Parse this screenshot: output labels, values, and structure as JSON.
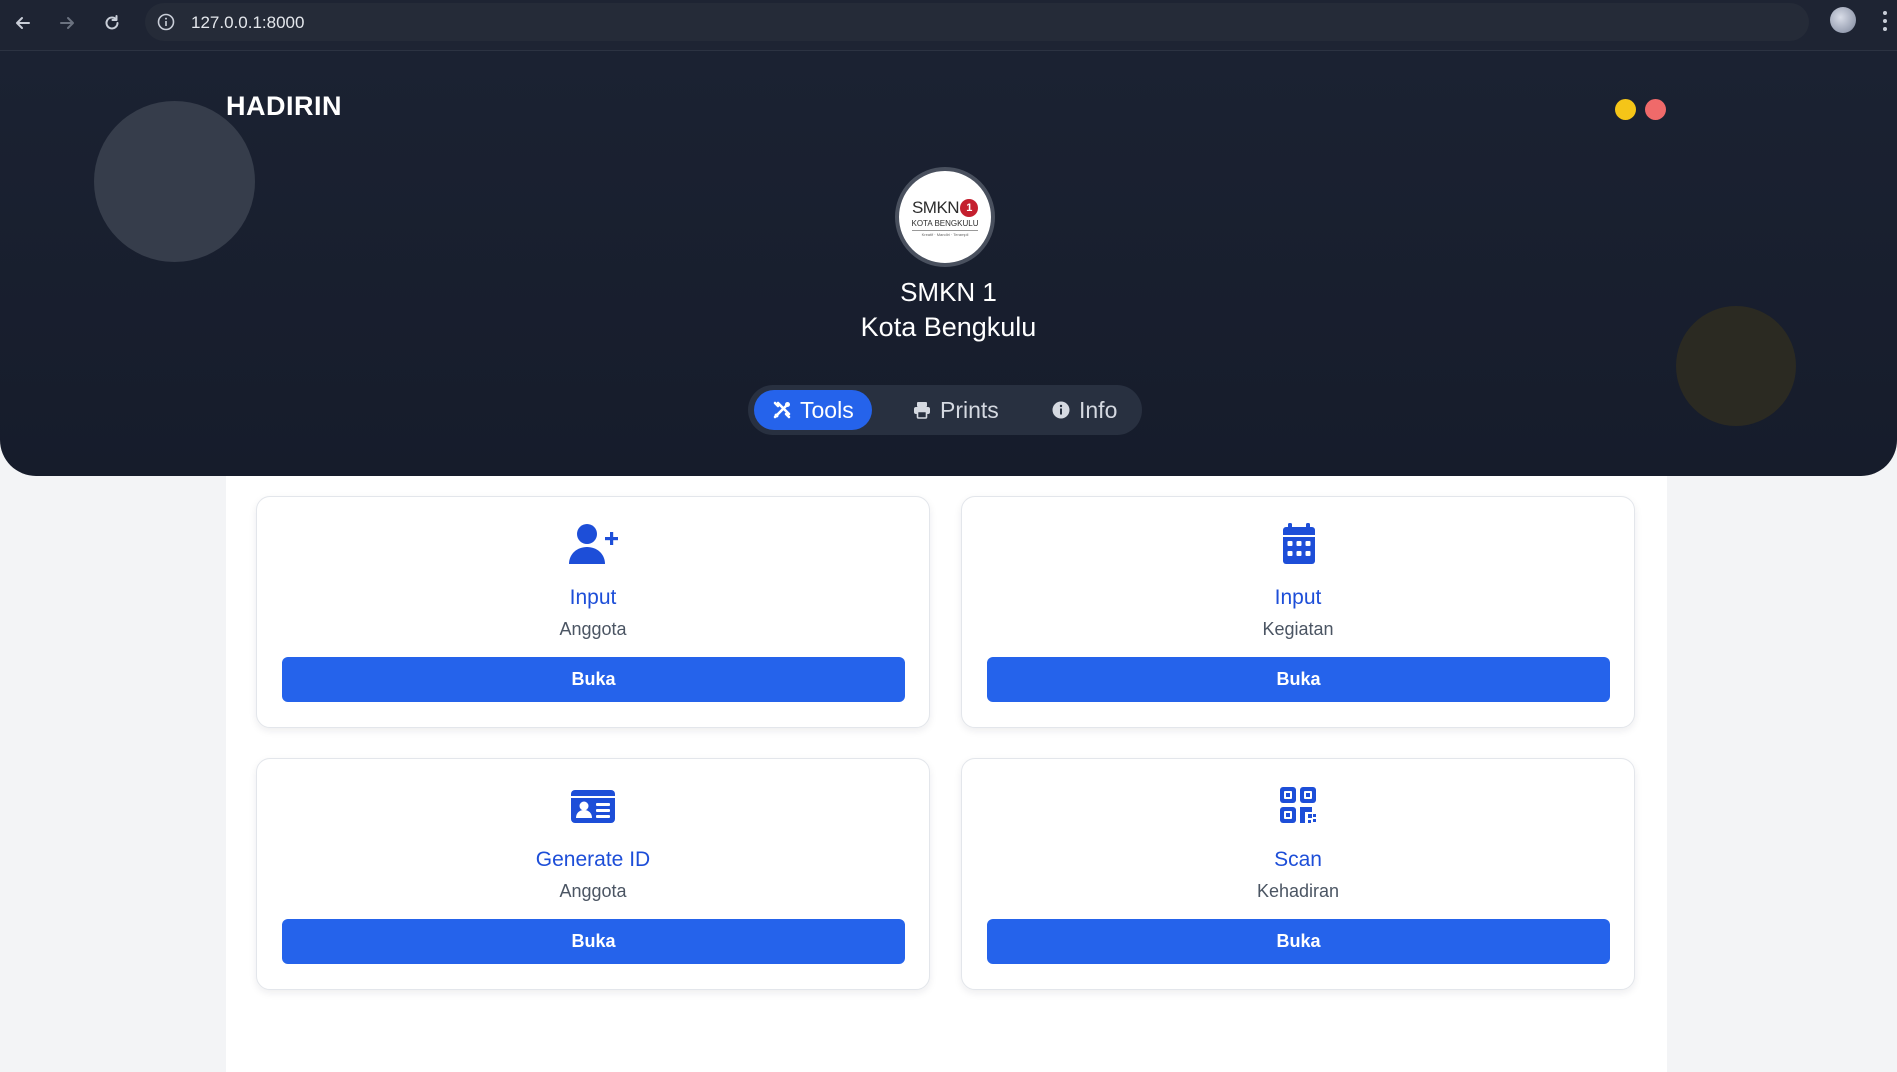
{
  "browser": {
    "url": "127.0.0.1:8000",
    "icons": {
      "back": "back-arrow-icon",
      "forward": "forward-arrow-icon",
      "reload": "reload-icon",
      "site_info": "info-icon",
      "bookmark": "star-icon",
      "profile": "avatar",
      "menu": "more-vert-icon"
    }
  },
  "header": {
    "brand": "HADIRIN",
    "school_line1": "SMKN 1",
    "school_line2": "Kota Bengkulu",
    "logo": {
      "top_text": "SMKN",
      "badge_text": "1",
      "sub_text": "KOTA BENGKULU",
      "tiny_text": "Kreatif · Mandiri · Terampil"
    },
    "status_dots": [
      "#f5c518",
      "#f06a6a"
    ]
  },
  "tabs": [
    {
      "label": "Tools",
      "icon": "tools-icon",
      "active": true
    },
    {
      "label": "Prints",
      "icon": "printer-icon",
      "active": false
    },
    {
      "label": "Info",
      "icon": "info-icon",
      "active": false
    }
  ],
  "cards": [
    {
      "title": "Input",
      "subtitle": "Anggota",
      "button": "Buka",
      "icon": "user-plus-icon"
    },
    {
      "title": "Input",
      "subtitle": "Kegiatan",
      "button": "Buka",
      "icon": "calendar-icon"
    },
    {
      "title": "Generate ID",
      "subtitle": "Anggota",
      "button": "Buka",
      "icon": "id-card-icon"
    },
    {
      "title": "Scan",
      "subtitle": "Kehadiran",
      "button": "Buka",
      "icon": "qrcode-icon"
    }
  ],
  "colors": {
    "accent": "#2563eb",
    "accent_text": "#1d4ed8",
    "hero_bg": "#1b2232",
    "tabbar_bg": "#283040"
  }
}
